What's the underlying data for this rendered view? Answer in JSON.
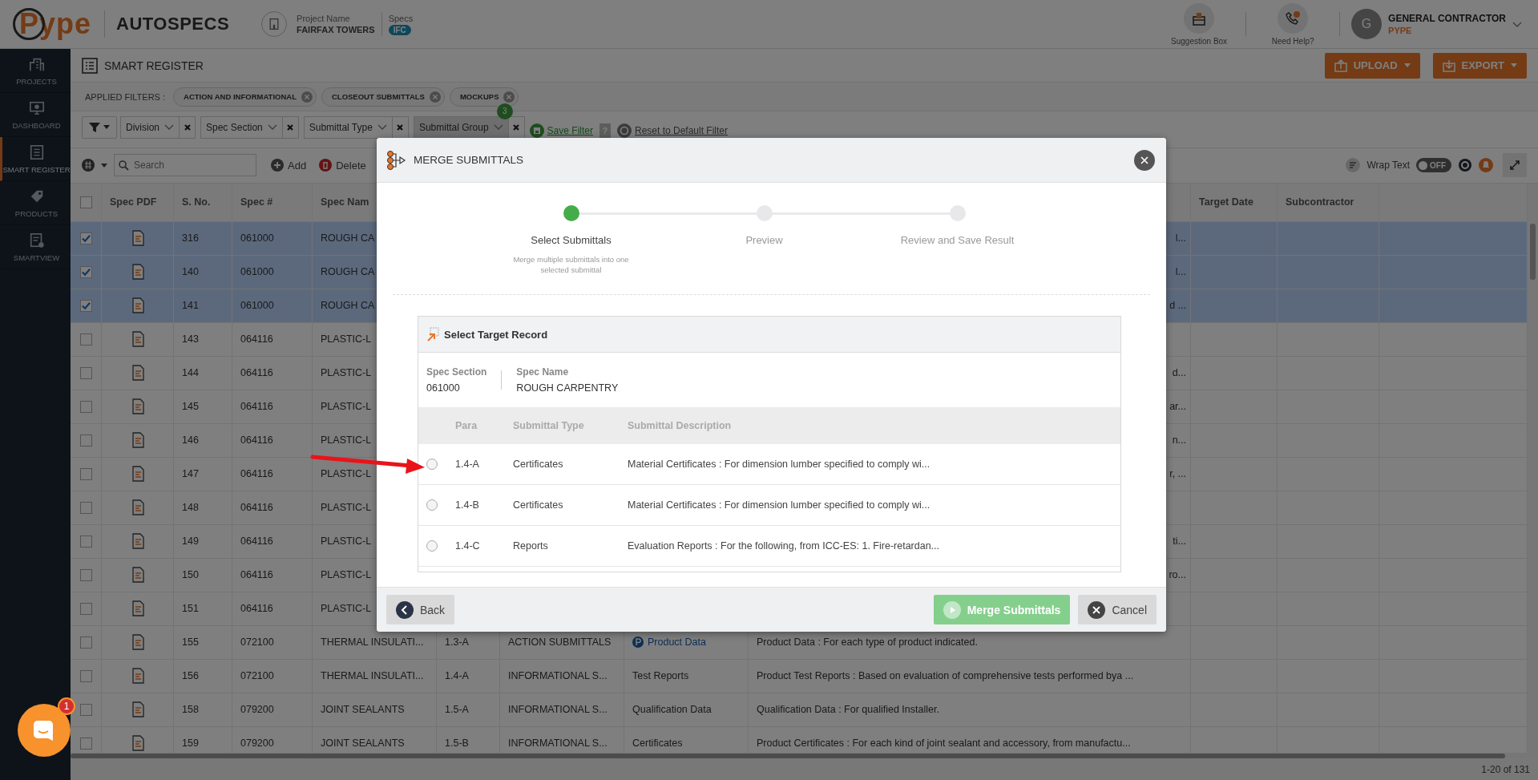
{
  "header": {
    "logo": "Pype",
    "product": "AUTOSPECS",
    "project_label": "Project Name",
    "project_name": "FAIRFAX TOWERS",
    "specs_label": "Specs",
    "specs_badge": "IFC",
    "actions": [
      {
        "kind": "suggestion",
        "label": "Suggestion Box"
      },
      {
        "kind": "help",
        "label": "Need Help?"
      }
    ],
    "user": {
      "initial": "G",
      "name": "GENERAL CONTRACTOR",
      "company": "PYPE"
    }
  },
  "sidebar": {
    "items": [
      {
        "kind": "projects",
        "label": "PROJECTS",
        "selected": false
      },
      {
        "kind": "dashboard",
        "label": "DASHBOARD",
        "selected": false
      },
      {
        "kind": "register",
        "label": "SMART REGISTER",
        "selected": true
      },
      {
        "kind": "products",
        "label": "PRODUCTS",
        "selected": false
      },
      {
        "kind": "smartview",
        "label": "SMARTVIEW",
        "selected": false
      }
    ]
  },
  "page": {
    "title": "SMART REGISTER",
    "buttons": [
      {
        "kind": "upload",
        "label": "UPLOAD"
      },
      {
        "kind": "export",
        "label": "EXPORT"
      }
    ]
  },
  "applied_filters": {
    "label": "APPLIED FILTERS :",
    "chips": [
      "ACTION AND INFORMATIONAL",
      "CLOSEOUT SUBMITTALS",
      "MOCKUPS"
    ]
  },
  "filter_bar": {
    "fields": [
      {
        "label": "Division",
        "selected": false
      },
      {
        "label": "Spec Section",
        "selected": false
      },
      {
        "label": "Submittal Type",
        "selected": false
      },
      {
        "label": "Submittal Group",
        "selected": true,
        "count": "3"
      }
    ],
    "save": "Save Filter",
    "help": "?",
    "reset": "Reset to Default Filter"
  },
  "toolbar": {
    "search_placeholder": "Search",
    "add": "Add",
    "delete": "Delete",
    "wrap_text": "Wrap Text",
    "wrap_on": false,
    "toggle_label": "OFF"
  },
  "table": {
    "all_selected": false,
    "columns_left": [
      "Spec PDF",
      "S. No.",
      "Spec #",
      "Spec Nam"
    ],
    "columns_right": [
      "Target Date",
      "Subcontractor"
    ],
    "rows": [
      {
        "kind": "covered",
        "selected": true,
        "s_no": "316",
        "spec": "061000",
        "name": "ROUGH CA",
        "tail": "l..."
      },
      {
        "kind": "covered",
        "selected": true,
        "s_no": "140",
        "spec": "061000",
        "name": "ROUGH CA",
        "tail": "l..."
      },
      {
        "kind": "covered",
        "selected": true,
        "s_no": "141",
        "spec": "061000",
        "name": "ROUGH CA",
        "tail": "d ..."
      },
      {
        "kind": "covered",
        "selected": false,
        "s_no": "143",
        "spec": "064116",
        "name": "PLASTIC-L"
      },
      {
        "kind": "covered",
        "selected": false,
        "s_no": "144",
        "spec": "064116",
        "name": "PLASTIC-L",
        "tail": "d..."
      },
      {
        "kind": "covered",
        "selected": false,
        "s_no": "145",
        "spec": "064116",
        "name": "PLASTIC-L",
        "tail": "ar..."
      },
      {
        "kind": "covered",
        "selected": false,
        "s_no": "146",
        "spec": "064116",
        "name": "PLASTIC-L",
        "tail": "n..."
      },
      {
        "kind": "covered",
        "selected": false,
        "s_no": "147",
        "spec": "064116",
        "name": "PLASTIC-L",
        "tail": "r, ..."
      },
      {
        "kind": "covered",
        "selected": false,
        "s_no": "148",
        "spec": "064116",
        "name": "PLASTIC-L"
      },
      {
        "kind": "covered",
        "selected": false,
        "s_no": "149",
        "spec": "064116",
        "name": "PLASTIC-L",
        "tail": "ti..."
      },
      {
        "kind": "covered",
        "selected": false,
        "s_no": "150",
        "spec": "064116",
        "name": "PLASTIC-L",
        "tail": "ro..."
      },
      {
        "kind": "covered",
        "selected": false,
        "s_no": "151",
        "spec": "064116",
        "name": "PLASTIC-L"
      },
      {
        "kind": "full",
        "selected": false,
        "s_no": "155",
        "spec": "072100",
        "name": "THERMAL INSULATI...",
        "para": "1.3-A",
        "group": "ACTION SUBMITTALS",
        "type": "Product Data",
        "type_link": true,
        "description": "Product Data : For each type of product indicated."
      },
      {
        "kind": "full",
        "selected": false,
        "s_no": "156",
        "spec": "072100",
        "name": "THERMAL INSULATI...",
        "para": "1.4-A",
        "group": "INFORMATIONAL S...",
        "type": "Test Reports",
        "type_link": false,
        "description": "Product Test Reports : Based on evaluation of comprehensive tests performed bya ..."
      },
      {
        "kind": "full",
        "selected": false,
        "s_no": "158",
        "spec": "079200",
        "name": "JOINT SEALANTS",
        "para": "1.5-A",
        "group": "INFORMATIONAL S...",
        "type": "Qualification Data",
        "type_link": false,
        "description": "Qualification Data : For qualified Installer."
      },
      {
        "kind": "full",
        "selected": false,
        "s_no": "159",
        "spec": "079200",
        "name": "JOINT SEALANTS",
        "para": "1.5-B",
        "group": "INFORMATIONAL S...",
        "type": "Certificates",
        "type_link": false,
        "description": "Product Certificates : For each kind of joint sealant and accessory, from manufactu..."
      }
    ]
  },
  "status_bar": {
    "range": "1-20 of 131"
  },
  "chat": {
    "badge": "1"
  },
  "modal": {
    "title": "MERGE SUBMITTALS",
    "steps": [
      {
        "label": "Select Submittals",
        "selected": true,
        "hint": "Merge multiple submittals into one selected submittal"
      },
      {
        "label": "Preview",
        "selected": false
      },
      {
        "label": "Review and Save Result",
        "selected": false
      }
    ],
    "target": {
      "title": "Select Target Record",
      "section_label": "Spec Section",
      "section": "061000",
      "name_label": "Spec Name",
      "name": "ROUGH CARPENTRY",
      "columns": [
        "Para",
        "Submittal Type",
        "Submittal Description"
      ],
      "rows": [
        {
          "selected": false,
          "para": "1.4-A",
          "type": "Certificates",
          "description": "Material Certificates : For dimension lumber specified to comply wi..."
        },
        {
          "selected": false,
          "para": "1.4-B",
          "type": "Certificates",
          "description": "Material Certificates : For dimension lumber specified to comply wi..."
        },
        {
          "selected": false,
          "para": "1.4-C",
          "type": "Reports",
          "description": "Evaluation Reports : For the following, from ICC-ES: 1. Fire-retardan..."
        }
      ]
    },
    "buttons": {
      "back": "Back",
      "merge": "Merge Submittals",
      "merge_disabled": true,
      "cancel": "Cancel"
    }
  }
}
